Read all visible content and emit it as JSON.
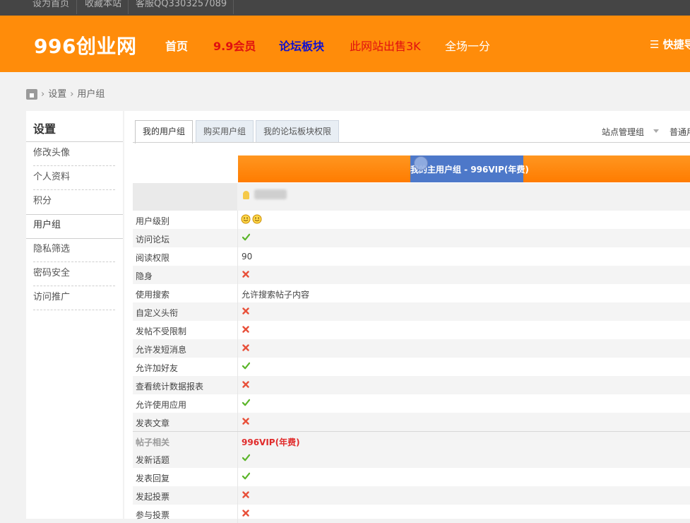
{
  "topbar": {
    "links": [
      "设为首页",
      "收藏本站"
    ],
    "service": "客服QQ3303257089"
  },
  "header": {
    "logo": "996创业网",
    "nav": [
      {
        "label": "首页",
        "color": "#ffffff"
      },
      {
        "label": "9.9会员",
        "color": "#e01010"
      },
      {
        "label": "论坛板块",
        "color": "#1010d0"
      },
      {
        "label": "此网站出售3K",
        "color": "#e01010"
      },
      {
        "label": "全场一分",
        "color": "#ffffff"
      }
    ],
    "quick": "☰ 快捷导航",
    "bg_color": "#ff8c0a"
  },
  "breadcrumb": {
    "items": [
      "设置",
      "用户组"
    ]
  },
  "sidebar": {
    "title": "设置",
    "items": [
      {
        "label": "修改头像",
        "active": false
      },
      {
        "label": "个人资料",
        "active": false
      },
      {
        "label": "积分",
        "active": false
      },
      {
        "label": "用户组",
        "active": true
      },
      {
        "label": "隐私筛选",
        "active": false
      },
      {
        "label": "密码安全",
        "active": false
      },
      {
        "label": "访问推广",
        "active": false
      }
    ]
  },
  "tabs": [
    {
      "label": "我的用户组",
      "active": true
    },
    {
      "label": "购买用户组",
      "active": false
    },
    {
      "label": "我的论坛板块权限",
      "active": false
    }
  ],
  "right_controls": {
    "site_admin": "站点管理组",
    "normal": "普通用户组"
  },
  "group_header": {
    "text": "我的主用户组 - 996VIP(年费)"
  },
  "permissions": [
    {
      "label": "用户级别",
      "type": "stars",
      "count": 2
    },
    {
      "label": "访问论坛",
      "type": "check"
    },
    {
      "label": "阅读权限",
      "type": "text",
      "value": "90"
    },
    {
      "label": "隐身",
      "type": "cross"
    },
    {
      "label": "使用搜索",
      "type": "text",
      "value": "允许搜索帖子内容"
    },
    {
      "label": "自定义头衔",
      "type": "cross"
    },
    {
      "label": "发帖不受限制",
      "type": "cross"
    },
    {
      "label": "允许发短消息",
      "type": "cross"
    },
    {
      "label": "允许加好友",
      "type": "check"
    },
    {
      "label": "查看统计数据报表",
      "type": "cross"
    },
    {
      "label": "允许使用应用",
      "type": "check"
    },
    {
      "label": "发表文章",
      "type": "cross"
    },
    {
      "label": "帖子相关",
      "type": "section",
      "value": "996VIP(年费)"
    },
    {
      "label": "发新话题",
      "type": "check"
    },
    {
      "label": "发表回复",
      "type": "check"
    },
    {
      "label": "发起投票",
      "type": "cross"
    },
    {
      "label": "参与投票",
      "type": "cross"
    }
  ],
  "colors": {
    "check": "#5bb52a",
    "cross": "#e8503a",
    "accent_red": "#e02b2b",
    "band_orange": "#ff8400",
    "band_highlight": "#4d78c9"
  }
}
